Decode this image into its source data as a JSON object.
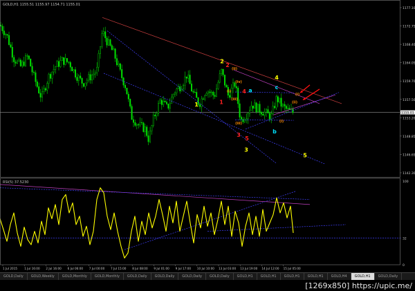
{
  "window": {
    "title": "GOLD,H1  1155.51 1155.97 1154.71 1155.01",
    "rsi_label": "RSI(5) 37.5230"
  },
  "watermark": "[1269x850] https://upic.me/",
  "tabs": [
    {
      "label": "GOLD,Daily"
    },
    {
      "label": "GOLD,Weekly"
    },
    {
      "label": "GOLD,Monthly"
    },
    {
      "label": "GOLD,Monthly"
    },
    {
      "label": "GOLD,Daily"
    },
    {
      "label": "GOLD,Daily"
    },
    {
      "label": "GOLD,Daily"
    },
    {
      "label": "GOLD,Daily"
    },
    {
      "label": "GOLD,H1"
    },
    {
      "label": "GOLD,H1"
    },
    {
      "label": "GOLD,H1"
    },
    {
      "label": "GOLD,H1"
    },
    {
      "label": "GOLD,H4"
    },
    {
      "label": "GOLD,H1",
      "active": true
    },
    {
      "label": "GOLD,Daily"
    }
  ],
  "colors": {
    "background": "#000000",
    "candle": "#00e000",
    "rsi": "#ffff00",
    "axis_text": "#c8c8c8",
    "trend_red": "#d04040",
    "trend_blue": "#4040ff",
    "trend_magenta": "#c040c0",
    "wave_yellow": "#ffff00",
    "wave_red": "#ff2020",
    "wave_cyan": "#00e0ff",
    "wave_orange": "#ff8c00",
    "arrow": "#ff1010"
  },
  "chart_data": [
    {
      "type": "candlestick",
      "symbol": "GOLD",
      "timeframe": "H1",
      "current_price": 1155.01,
      "ylim": [
        1139.5,
        1181.5
      ],
      "y_ticks": [
        "1177.10",
        "1172.75",
        "1168.40",
        "1164.05",
        "1159.70",
        "1157.50",
        "1153.20",
        "1148.85",
        "1146.65",
        "1142.30"
      ],
      "x_ticks": [
        "1 Jul 2015",
        "1 Jul 16:00",
        "2 Jul 16:00",
        "6 Jul 06:00",
        "7 Jul 00:00",
        "7 Jul 15:00",
        "8 Jul 08:00",
        "9 Jul 01:00",
        "9 Jul 17:00",
        "10 Jul 10:00",
        "13 Jul 03:00",
        "13 Jul 19:00",
        "14 Jul 12:00",
        "15 Jul 05:00"
      ],
      "price_label": "1155.01",
      "close_path": [
        [
          0,
          1176.0
        ],
        [
          10,
          1173.5
        ],
        [
          20,
          1168.0
        ],
        [
          30,
          1166.0
        ],
        [
          40,
          1168.5
        ],
        [
          50,
          1163.0
        ],
        [
          60,
          1158.5
        ],
        [
          70,
          1163.5
        ],
        [
          80,
          1166.0
        ],
        [
          90,
          1167.5
        ],
        [
          100,
          1167.0
        ],
        [
          110,
          1164.0
        ],
        [
          120,
          1162.0
        ],
        [
          130,
          1163.5
        ],
        [
          140,
          1165.0
        ],
        [
          148,
          1174.5
        ],
        [
          155,
          1172.0
        ],
        [
          165,
          1169.0
        ],
        [
          175,
          1164.0
        ],
        [
          182,
          1161.0
        ],
        [
          190,
          1154.0
        ],
        [
          200,
          1152.0
        ],
        [
          210,
          1151.0
        ],
        [
          215,
          1148.5
        ],
        [
          222,
          1153.5
        ],
        [
          232,
          1158.0
        ],
        [
          242,
          1156.0
        ],
        [
          252,
          1160.0
        ],
        [
          262,
          1161.5
        ],
        [
          270,
          1164.0
        ],
        [
          278,
          1160.0
        ],
        [
          288,
          1157.0
        ],
        [
          298,
          1160.5
        ],
        [
          310,
          1159.0
        ],
        [
          320,
          1165.0
        ],
        [
          330,
          1159.0
        ],
        [
          340,
          1162.0
        ],
        [
          348,
          1153.0
        ],
        [
          356,
          1154.5
        ],
        [
          364,
          1157.0
        ],
        [
          372,
          1156.0
        ],
        [
          382,
          1155.0
        ],
        [
          392,
          1154.0
        ],
        [
          400,
          1158.5
        ],
        [
          408,
          1156.5
        ],
        [
          416,
          1155.5
        ],
        [
          424,
          1155.0
        ]
      ],
      "annotations": [
        {
          "text": "2",
          "color": "yellow",
          "x": 321,
          "y": 1166.8
        },
        {
          "text": "2",
          "color": "red",
          "x": 329,
          "y": 1165.9
        },
        {
          "text": "(ii)",
          "color": "orange",
          "x": 339,
          "y": 1165.2
        },
        {
          "text": "1",
          "color": "yellow",
          "x": 284,
          "y": 1156.4
        },
        {
          "text": "1",
          "color": "red",
          "x": 320,
          "y": 1157.0
        },
        {
          "text": "(iii)",
          "color": "orange",
          "x": 339,
          "y": 1157.9
        },
        {
          "text": "(i)",
          "color": "orange",
          "x": 331,
          "y": 1159.8
        },
        {
          "text": "(iv)",
          "color": "orange",
          "x": 345,
          "y": 1162.1
        },
        {
          "text": "a",
          "color": "cyan",
          "x": 362,
          "y": 1159.8
        },
        {
          "text": "4",
          "color": "red",
          "x": 353,
          "y": 1159.6
        },
        {
          "text": "4",
          "color": "yellow",
          "x": 400,
          "y": 1162.9
        },
        {
          "text": "c",
          "color": "cyan",
          "x": 400,
          "y": 1160.6
        },
        {
          "text": "(i)",
          "color": "orange",
          "x": 430,
          "y": 1159.1
        },
        {
          "text": "(ii)",
          "color": "orange",
          "x": 426,
          "y": 1157.2
        },
        {
          "text": "(iii)",
          "color": "orange",
          "x": 345,
          "y": 1152.1
        },
        {
          "text": "(i)",
          "color": "orange",
          "x": 407,
          "y": 1152.6
        },
        {
          "text": "b",
          "color": "cyan",
          "x": 397,
          "y": 1150.0
        },
        {
          "text": "3",
          "color": "red",
          "x": 345,
          "y": 1149.1
        },
        {
          "text": "5",
          "color": "red",
          "x": 357,
          "y": 1148.3
        },
        {
          "text": "3",
          "color": "yellow",
          "x": 356,
          "y": 1145.6
        },
        {
          "text": "5",
          "color": "yellow",
          "x": 441,
          "y": 1144.2
        }
      ],
      "trendlines": [
        {
          "color": "red",
          "x1": 148,
          "y1": 1177.8,
          "x2": 494,
          "y2": 1157.1
        },
        {
          "color": "magenta",
          "x1": 338,
          "y1": 1165.2,
          "x2": 462,
          "y2": 1157.1
        },
        {
          "color": "magenta",
          "x1": 395,
          "y1": 1154.4,
          "x2": 485,
          "y2": 1159.2
        },
        {
          "color": "blue",
          "x1": 355,
          "y1": 1151.0,
          "x2": 490,
          "y2": 1159.8
        },
        {
          "color": "blue",
          "x1": 155,
          "y1": 1174.6,
          "x2": 400,
          "y2": 1142.7
        },
        {
          "color": "blue",
          "x1": 150,
          "y1": 1164.4,
          "x2": 470,
          "y2": 1142.6
        },
        {
          "color": "blue",
          "x1": 340,
          "y1": 1159.9,
          "x2": 425,
          "y2": 1159.7
        },
        {
          "color": "blue",
          "x1": 340,
          "y1": 1153.2,
          "x2": 425,
          "y2": 1153.1
        }
      ],
      "arrows": [
        {
          "x1": 448,
          "y1": 1161.6,
          "x2": 434,
          "y2": 1159.7
        },
        {
          "x1": 462,
          "y1": 1160.6,
          "x2": 438,
          "y2": 1158.0
        }
      ]
    },
    {
      "type": "line",
      "indicator": "RSI(5)",
      "current_value": 37.523,
      "ylim": [
        0,
        100
      ],
      "y_ticks": [
        "100",
        "32",
        "0"
      ],
      "values": [
        [
          0,
          55
        ],
        [
          5,
          42
        ],
        [
          10,
          28
        ],
        [
          15,
          48
        ],
        [
          20,
          62
        ],
        [
          25,
          38
        ],
        [
          30,
          22
        ],
        [
          35,
          45
        ],
        [
          40,
          30
        ],
        [
          45,
          24
        ],
        [
          50,
          40
        ],
        [
          55,
          26
        ],
        [
          60,
          52
        ],
        [
          65,
          36
        ],
        [
          70,
          68
        ],
        [
          75,
          55
        ],
        [
          80,
          72
        ],
        [
          85,
          48
        ],
        [
          90,
          78
        ],
        [
          95,
          84
        ],
        [
          100,
          62
        ],
        [
          105,
          74
        ],
        [
          110,
          48
        ],
        [
          115,
          58
        ],
        [
          120,
          34
        ],
        [
          125,
          46
        ],
        [
          130,
          24
        ],
        [
          135,
          40
        ],
        [
          140,
          78
        ],
        [
          145,
          92
        ],
        [
          150,
          86
        ],
        [
          155,
          58
        ],
        [
          160,
          42
        ],
        [
          165,
          62
        ],
        [
          170,
          40
        ],
        [
          175,
          22
        ],
        [
          180,
          8
        ],
        [
          185,
          14
        ],
        [
          190,
          40
        ],
        [
          195,
          58
        ],
        [
          200,
          28
        ],
        [
          205,
          52
        ],
        [
          210,
          36
        ],
        [
          215,
          62
        ],
        [
          220,
          44
        ],
        [
          225,
          58
        ],
        [
          230,
          78
        ],
        [
          235,
          60
        ],
        [
          240,
          40
        ],
        [
          245,
          70
        ],
        [
          250,
          50
        ],
        [
          255,
          76
        ],
        [
          260,
          40
        ],
        [
          265,
          58
        ],
        [
          270,
          76
        ],
        [
          275,
          50
        ],
        [
          280,
          26
        ],
        [
          285,
          60
        ],
        [
          290,
          44
        ],
        [
          295,
          70
        ],
        [
          300,
          46
        ],
        [
          305,
          62
        ],
        [
          310,
          36
        ],
        [
          315,
          54
        ],
        [
          320,
          76
        ],
        [
          325,
          48
        ],
        [
          330,
          70
        ],
        [
          335,
          34
        ],
        [
          340,
          64
        ],
        [
          345,
          50
        ],
        [
          350,
          22
        ],
        [
          355,
          46
        ],
        [
          360,
          62
        ],
        [
          365,
          36
        ],
        [
          370,
          58
        ],
        [
          375,
          34
        ],
        [
          380,
          66
        ],
        [
          385,
          40
        ],
        [
          390,
          50
        ],
        [
          395,
          60
        ],
        [
          400,
          80
        ],
        [
          405,
          62
        ],
        [
          410,
          74
        ],
        [
          415,
          56
        ],
        [
          420,
          70
        ],
        [
          424,
          38
        ]
      ],
      "trendlines": [
        {
          "color": "magenta",
          "x1": 0,
          "y1": 96,
          "x2": 448,
          "y2": 72
        },
        {
          "color": "blue",
          "x1": 0,
          "y1": 92,
          "x2": 448,
          "y2": 78
        },
        {
          "color": "blue",
          "x1": 180,
          "y1": 18,
          "x2": 428,
          "y2": 88
        },
        {
          "color": "blue",
          "x1": 300,
          "y1": 40,
          "x2": 500,
          "y2": 48
        },
        {
          "color": "blue",
          "x1": 0,
          "y1": 32,
          "x2": 580,
          "y2": 32
        }
      ]
    }
  ]
}
